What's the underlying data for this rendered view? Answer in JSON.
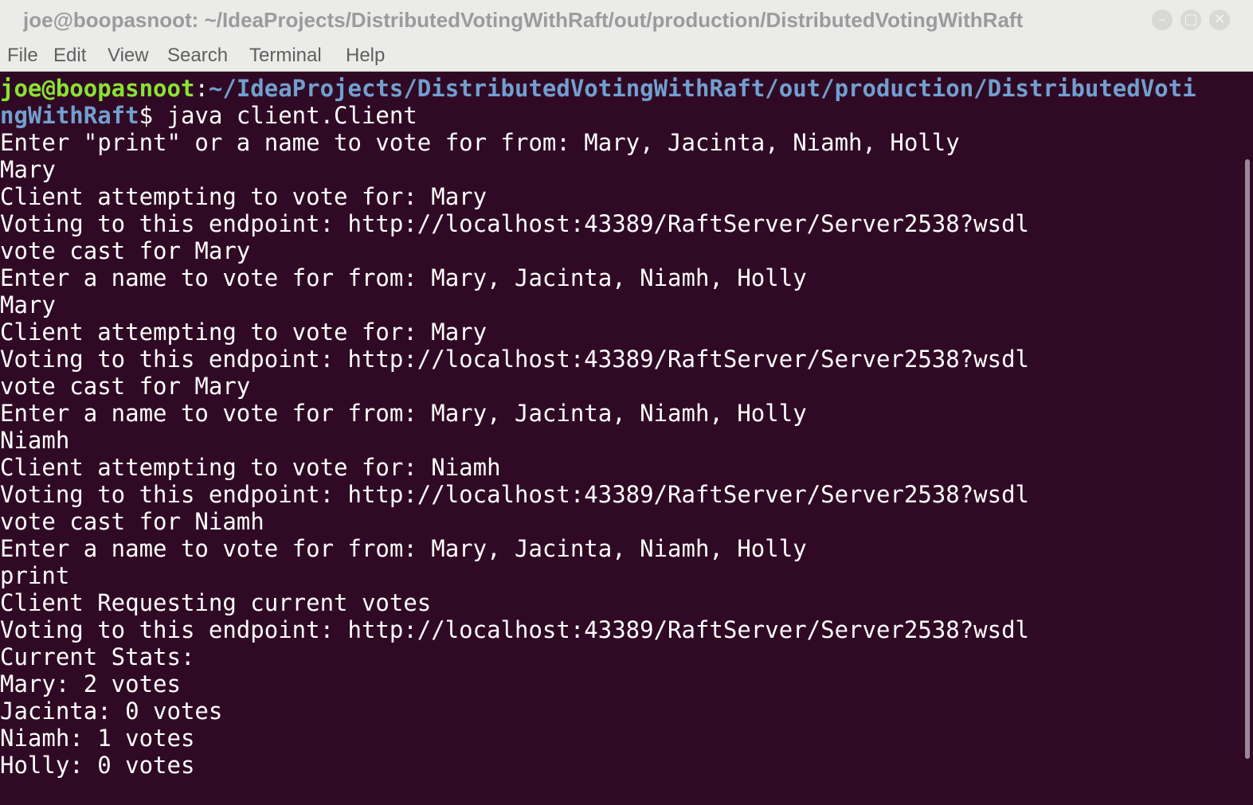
{
  "window": {
    "title": "joe@boopasnoot: ~/IdeaProjects/DistributedVotingWithRaft/out/production/DistributedVotingWithRaft",
    "minimize_glyph": "–",
    "maximize_glyph": "□",
    "close_glyph": "✕"
  },
  "menu": [
    "File",
    "Edit",
    "View",
    "Search",
    "Terminal",
    "Help"
  ],
  "colors": {
    "background": "#300a24",
    "text": "#ffffff",
    "prompt_user": "#8ae234",
    "prompt_path": "#729fcf"
  },
  "prompt": {
    "user_host": "joe@boopasnoot",
    "separator": ":",
    "path_line1": "~/IdeaProjects/DistributedVotingWithRaft/out/production/DistributedVoti",
    "path_line2": "ngWithRaft",
    "symbol": "$",
    "command": " java client.Client"
  },
  "output": [
    "Enter \"print\" or a name to vote for from: Mary, Jacinta, Niamh, Holly",
    "Mary",
    "Client attempting to vote for: Mary",
    "Voting to this endpoint: http://localhost:43389/RaftServer/Server2538?wsdl",
    "vote cast for Mary",
    "Enter a name to vote for from: Mary, Jacinta, Niamh, Holly",
    "Mary",
    "Client attempting to vote for: Mary",
    "Voting to this endpoint: http://localhost:43389/RaftServer/Server2538?wsdl",
    "vote cast for Mary",
    "Enter a name to vote for from: Mary, Jacinta, Niamh, Holly",
    "Niamh",
    "Client attempting to vote for: Niamh",
    "Voting to this endpoint: http://localhost:43389/RaftServer/Server2538?wsdl",
    "vote cast for Niamh",
    "Enter a name to vote for from: Mary, Jacinta, Niamh, Holly",
    "print",
    "Client Requesting current votes",
    "Voting to this endpoint: http://localhost:43389/RaftServer/Server2538?wsdl",
    "Current Stats:",
    "Mary: 2 votes",
    "Jacinta: 0 votes",
    "Niamh: 1 votes",
    "Holly: 0 votes"
  ]
}
